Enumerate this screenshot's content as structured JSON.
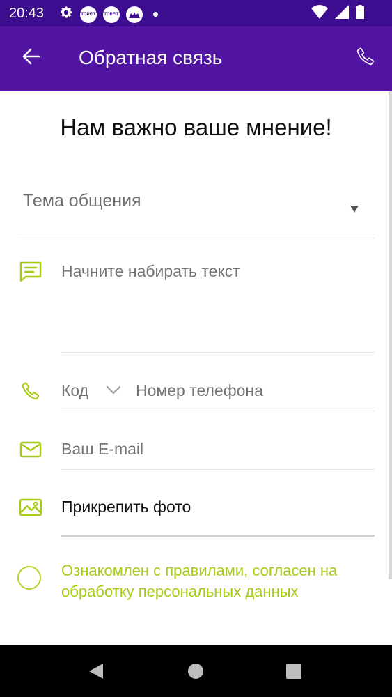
{
  "status_bar": {
    "time": "20:43",
    "badges": [
      "TOPFIT",
      "TOPFIT"
    ],
    "icons": [
      "gear-icon",
      "wifi-icon",
      "signal-icon",
      "battery-icon"
    ]
  },
  "app_bar": {
    "title": "Обратная связь",
    "color": "#5214a3"
  },
  "form": {
    "headline": "Нам важно ваше мнение!",
    "topic_placeholder": "Тема общения",
    "message_placeholder": "Начните набирать текст",
    "phone_code_label": "Код",
    "phone_placeholder": "Номер телефона",
    "email_placeholder": "Ваш E-mail",
    "attach_label": "Прикрепить фото",
    "consent_text": "Ознакомлен с правилами, согласен на обработку персональных данных",
    "accent_color": "#a7cc16"
  }
}
